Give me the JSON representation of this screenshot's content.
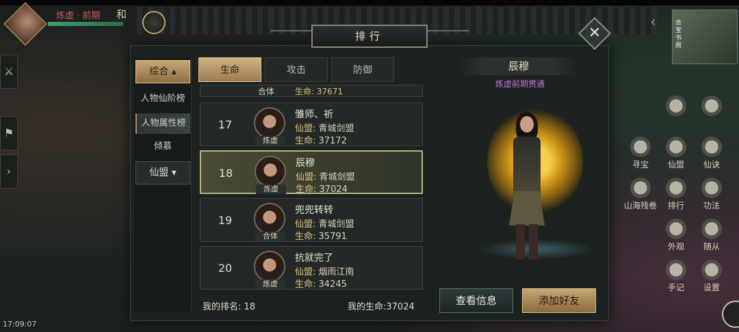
{
  "hud": {
    "player_name": "炼虚 · 前期",
    "player_mark": "和",
    "minimap_lines": [
      "合",
      "宝",
      "书",
      "阁"
    ],
    "time": "17:09:07"
  },
  "panel": {
    "title": "排行",
    "close_glyph": "✕"
  },
  "leftnav": {
    "main": "综合",
    "items": [
      "人物仙阶榜",
      "人物属性榜",
      "倾慕"
    ],
    "active_index": 1,
    "sub": "仙盟"
  },
  "tabs": [
    "生命",
    "攻击",
    "防御"
  ],
  "active_tab": 0,
  "list": {
    "partial": {
      "realm": "合体",
      "hp_label": "生命:",
      "hp": "37671"
    },
    "guild_label": "仙盟:",
    "hp_label": "生命:",
    "rows": [
      {
        "rank": "17",
        "name": "雏师、祈",
        "realm": "炼虚",
        "guild": "青城剑盟",
        "hp": "37172"
      },
      {
        "rank": "18",
        "name": "辰穆",
        "realm": "炼虚",
        "guild": "青城剑盟",
        "hp": "37024"
      },
      {
        "rank": "19",
        "name": "兜兜转转",
        "realm": "合体",
        "guild": "青城剑盟",
        "hp": "35791"
      },
      {
        "rank": "20",
        "name": "抗就完了",
        "realm": "炼虚",
        "guild": "烟雨江南",
        "hp": "34245"
      }
    ],
    "selected_index": 1
  },
  "footer": {
    "my_rank": "我的排名: 18",
    "my_hp": "我的生命:37024"
  },
  "detail": {
    "name": "辰穆",
    "title": "炼虚前期贯通",
    "buttons": {
      "info": "查看信息",
      "friend": "添加好友"
    }
  },
  "side_skills": [
    {
      "label": "寻宝"
    },
    {
      "label": "仙盟"
    },
    {
      "label": "仙诀"
    },
    {
      "label": "山海残卷"
    },
    {
      "label": "排行"
    },
    {
      "label": "功法"
    },
    {
      "label": "外观"
    },
    {
      "label": "随从"
    },
    {
      "label": "手记"
    },
    {
      "label": "设置"
    }
  ]
}
